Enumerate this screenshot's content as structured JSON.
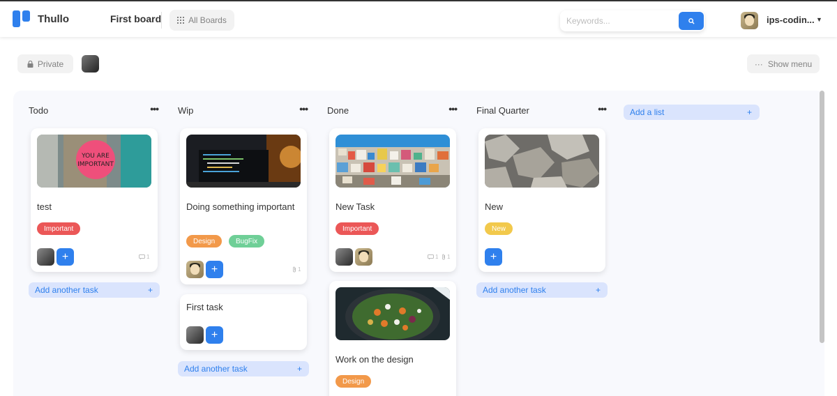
{
  "app": {
    "name": "Thullo",
    "brand_color": "#2F80ED"
  },
  "header": {
    "board_name": "First board",
    "all_boards_label": "All Boards",
    "search_placeholder": "Keywords...",
    "user_name": "ips-codin..."
  },
  "subheader": {
    "visibility_label": "Private",
    "menu_label": "Show menu"
  },
  "lists": [
    {
      "title": "Todo",
      "cards": [
        {
          "title": "test",
          "image": "you-are-important-sticker",
          "labels": [
            {
              "text": "Important",
              "color": "#EB5757"
            }
          ],
          "comments": "1",
          "attachments": ""
        }
      ],
      "add_label": "Add another task"
    },
    {
      "title": "Wip",
      "cards": [
        {
          "title": "Doing something important",
          "image": "laptop-code",
          "labels": [
            {
              "text": "Design",
              "color": "#F2994A"
            },
            {
              "text": "BugFix",
              "color": "#6FCF97"
            }
          ],
          "comments": "",
          "attachments": "1"
        },
        {
          "title": "First task",
          "image": "",
          "labels": [],
          "comments": "",
          "attachments": ""
        }
      ],
      "add_label": "Add another task"
    },
    {
      "title": "Done",
      "cards": [
        {
          "title": "New Task",
          "image": "colorful-city",
          "labels": [
            {
              "text": "Important",
              "color": "#EB5757"
            }
          ],
          "comments": "1",
          "attachments": "1"
        },
        {
          "title": "Work on the design",
          "image": "salad-plate",
          "labels": [
            {
              "text": "Design",
              "color": "#F2994A"
            }
          ],
          "comments": "",
          "attachments": ""
        }
      ],
      "add_label": ""
    },
    {
      "title": "Final Quarter",
      "cards": [
        {
          "title": "New",
          "image": "concrete-blocks",
          "labels": [
            {
              "text": "New",
              "color": "#F2C94C"
            }
          ],
          "comments": "",
          "attachments": ""
        }
      ],
      "add_label": "Add another task"
    }
  ],
  "add_list_label": "Add a list"
}
